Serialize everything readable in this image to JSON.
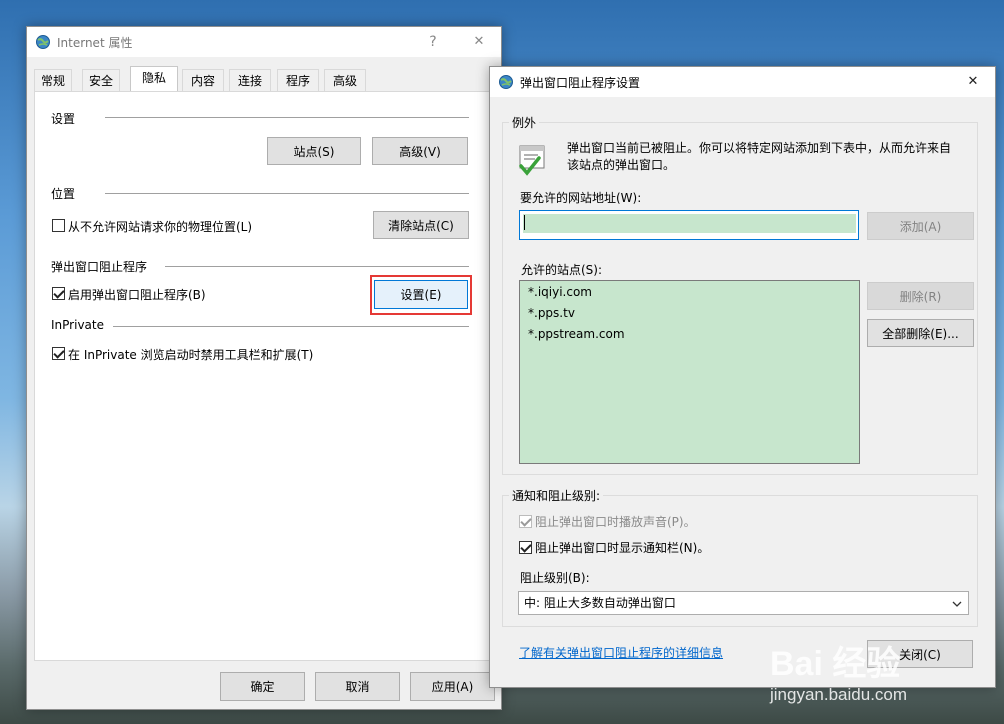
{
  "left_window": {
    "title": "Internet 属性",
    "help_btn": "?",
    "close_btn": "✕",
    "tabs": [
      "常规",
      "安全",
      "隐私",
      "内容",
      "连接",
      "程序",
      "高级"
    ],
    "active_tab": "隐私",
    "settings": {
      "heading": "设置",
      "sites_btn": "站点(S)",
      "advanced_btn": "高级(V)"
    },
    "location": {
      "heading": "位置",
      "checkbox_label": "从不允许网站请求你的物理位置(L)",
      "clear_btn": "清除站点(C)"
    },
    "popup": {
      "heading": "弹出窗口阻止程序",
      "checkbox_label": "启用弹出窗口阻止程序(B)",
      "settings_btn": "设置(E)"
    },
    "inprivate": {
      "heading": "InPrivate",
      "checkbox_label": "在 InPrivate 浏览启动时禁用工具栏和扩展(T)"
    },
    "footer": {
      "ok": "确定",
      "cancel": "取消",
      "apply": "应用(A)"
    }
  },
  "right_window": {
    "title": "弹出窗口阻止程序设置",
    "close_btn": "✕",
    "exceptions": {
      "heading": "例外",
      "info_text_line1": "弹出窗口当前已被阻止。你可以将特定网站添加到下表中，从而允许来自",
      "info_text_line2": "该站点的弹出窗口。",
      "address_label": "要允许的网站地址(W):",
      "address_value": "",
      "add_btn": "添加(A)",
      "allowed_label": "允许的站点(S):",
      "allowed_sites": [
        "*.iqiyi.com",
        "*.pps.tv",
        "*.ppstream.com"
      ],
      "remove_btn": "删除(R)",
      "remove_all_btn": "全部删除(E)..."
    },
    "notify": {
      "heading": "通知和阻止级别:",
      "sound_label": "阻止弹出窗口时播放声音(P)。",
      "bar_label": "阻止弹出窗口时显示通知栏(N)。",
      "level_label": "阻止级别(B):",
      "level_value": "中: 阻止大多数自动弹出窗口"
    },
    "learn_more": "了解有关弹出窗口阻止程序的详细信息",
    "close_dialog_btn": "关闭(C)"
  },
  "watermark": {
    "brand": "Bai 经验",
    "url": "jingyan.baidu.com"
  },
  "colors": {
    "highlight_red": "#e53935",
    "list_bg": "#c7e6cd",
    "link": "#0066cc"
  }
}
